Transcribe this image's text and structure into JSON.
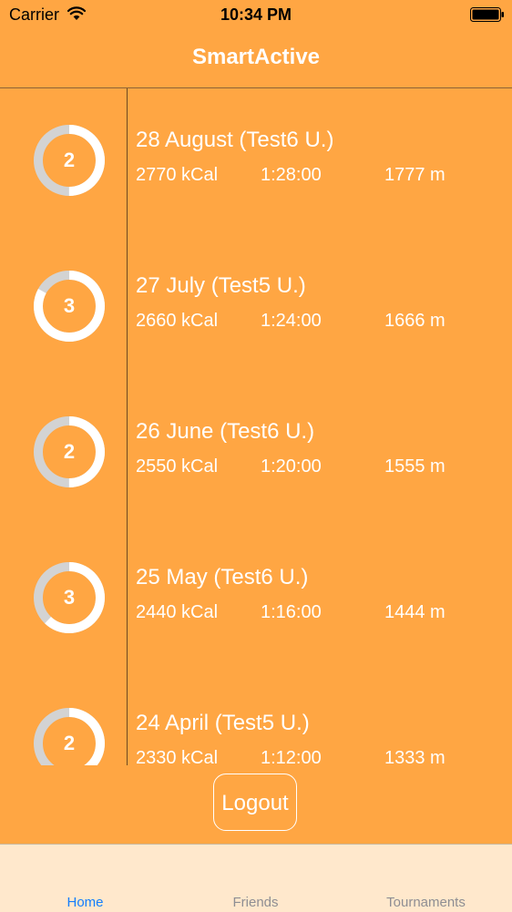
{
  "status_bar": {
    "carrier": "Carrier",
    "time": "10:34 PM",
    "wifi_icon": "wifi-icon",
    "battery_icon": "battery-icon"
  },
  "nav": {
    "title": "SmartActive"
  },
  "colors": {
    "background": "#FFA643",
    "ring_track": "#D3D3D3",
    "ring_fill": "#FFFFFF",
    "tab_bar_bg": "#FFE8CC",
    "tab_active": "#147EFB",
    "tab_inactive": "#8E8E93"
  },
  "entries": [
    {
      "rank": "2",
      "title": "28 August (Test6 U.)",
      "kcal": "2770 kCal",
      "duration": "1:28:00",
      "distance": "1777 m",
      "ring_progress": 0.5
    },
    {
      "rank": "3",
      "title": "27 July (Test5 U.)",
      "kcal": "2660 kCal",
      "duration": "1:24:00",
      "distance": "1666 m",
      "ring_progress": 0.83
    },
    {
      "rank": "2",
      "title": "26 June (Test6 U.)",
      "kcal": "2550 kCal",
      "duration": "1:20:00",
      "distance": "1555 m",
      "ring_progress": 0.5
    },
    {
      "rank": "3",
      "title": "25 May (Test6 U.)",
      "kcal": "2440 kCal",
      "duration": "1:16:00",
      "distance": "1444 m",
      "ring_progress": 0.62
    },
    {
      "rank": "2",
      "title": "24 April (Test5 U.)",
      "kcal": "2330 kCal",
      "duration": "1:12:00",
      "distance": "1333 m",
      "ring_progress": 0.5
    }
  ],
  "logout_label": "Logout",
  "tabs": [
    {
      "label": "Home",
      "active": true
    },
    {
      "label": "Friends",
      "active": false
    },
    {
      "label": "Tournaments",
      "active": false
    }
  ]
}
